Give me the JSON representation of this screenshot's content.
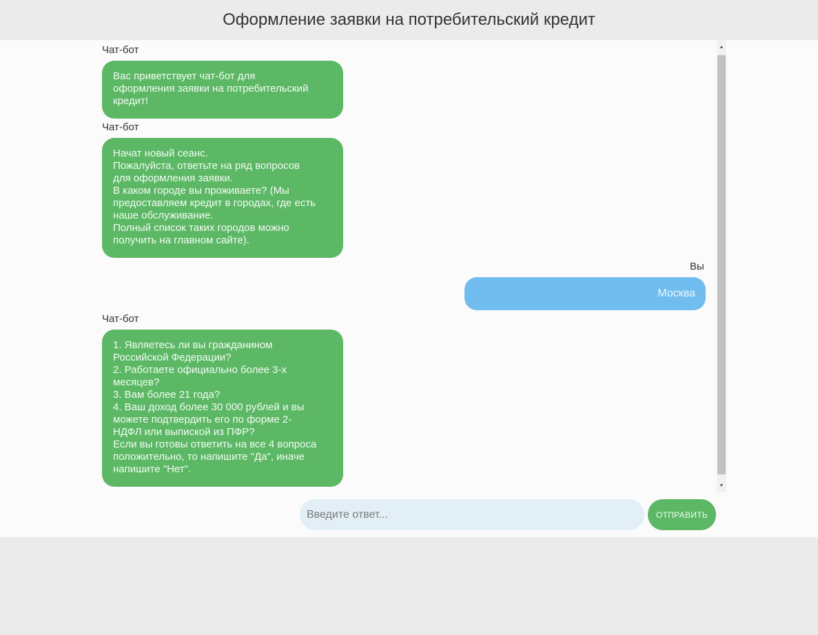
{
  "header": {
    "title": "Оформление заявки на потребительский кредит"
  },
  "messages": [
    {
      "sender": "Чат-бот",
      "text": "Вас приветствует чат-бот для\nоформления заявки на потребительский\nкредит!"
    },
    {
      "sender": "Чат-бот",
      "text": "Начат новый сеанс.\nПожалуйста, ответьте на ряд вопросов\nдля оформления заявки.\nВ каком городе вы проживаете? (Мы\nпредоставляем кредит в городах, где есть\nнаше обслуживание.\nПолный список таких городов можно\nполучить на главном сайте)."
    },
    {
      "sender": "Вы",
      "text": "Москва"
    },
    {
      "sender": "Чат-бот",
      "text": "1. Являетесь ли вы гражданином\nРоссийской Федерации?\n2. Работаете официально более 3-х\nмесяцев?\n3. Вам более 21 года?\n4. Ваш доход более 30 000 рублей и вы\nможете подтвердить его по форме 2-\nНДФЛ или выпиской из ПФР?\nЕсли вы готовы ответить на все 4 вопроса\nположительно, то напишите \"Да\", иначе\nнапишите \"Нет\"."
    }
  ],
  "input": {
    "placeholder": "Введите ответ...",
    "value": ""
  },
  "send_button": {
    "label": "ОТПРАВИТЬ"
  },
  "icons": {
    "scroll_up": "triangle-up-icon",
    "scroll_down": "triangle-down-icon"
  },
  "colors": {
    "bot_bubble": "#5cb865",
    "user_bubble": "#71bdef",
    "input_bg": "#e2eff7",
    "page_bg": "#ebebeb"
  }
}
